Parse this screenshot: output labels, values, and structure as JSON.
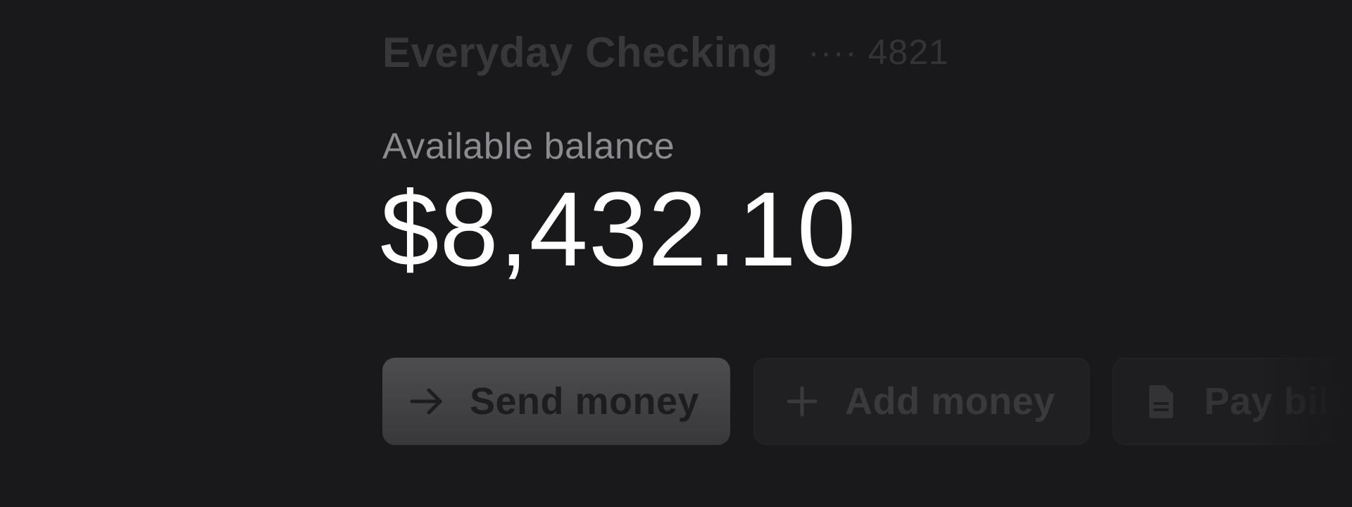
{
  "account": {
    "name": "Everyday Checking",
    "masked_number": "···· 4821"
  },
  "balance": {
    "label": "Available balance",
    "amount": "$8,432.10"
  },
  "actions": [
    {
      "label": "Send money",
      "icon": "arrow-right-icon"
    },
    {
      "label": "Add money",
      "icon": "plus-icon"
    },
    {
      "label": "Pay bills",
      "icon": "document-icon"
    }
  ],
  "colors": {
    "background": "#19191b",
    "balance_text": "#ffffff",
    "label_text": "#8b8b90",
    "primary_button": "#434346"
  }
}
